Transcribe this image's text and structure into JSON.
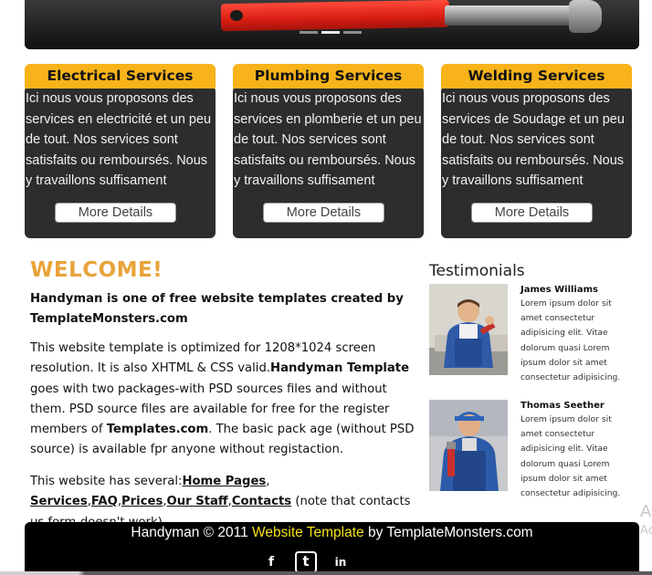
{
  "services": [
    {
      "title": "Electrical Services",
      "text": "Ici nous vous proposons des services en electricité et un peu de tout. Nos services sont satisfaits ou remboursés. Nous y travaillons suffisament",
      "button": "More Details"
    },
    {
      "title": "Plumbing Services",
      "text": "Ici nous vous proposons des services en plomberie et un peu de tout. Nos services sont satisfaits ou remboursés. Nous y travaillons suffisament",
      "button": "More Details"
    },
    {
      "title": "Welding Services",
      "text": "Ici nous vous proposons des services de Soudage et un peu de tout. Nos services sont satisfaits ou remboursés. Nous y travaillons suffisament",
      "button": "More Details"
    }
  ],
  "welcome": {
    "title": "WELCOME!",
    "intro": "Handyman is one of free website templates created by TemplateMonsters.com",
    "p2_a": "This website template is optimized for 1208*1024 screen resolution. It is also XHTML & CSS valid.",
    "p2_b": "Handyman Template",
    "p2_c": " goes with two packages-with PSD sources files and without them. PSD source files are available for free for the register members of ",
    "p2_d": "Templates.com",
    "p2_e": ". The basic pack age (without PSD source) is available fpr anyone without registaction.",
    "p3_a": "This website has several:",
    "links": [
      "Home Pages",
      "Services",
      "FAQ",
      "Prices",
      "Our Staff",
      "Contacts"
    ],
    "p3_b": " (note that contacts us form-doesn't work)."
  },
  "testimonials": {
    "title": "Testimonials",
    "items": [
      {
        "name": "James Williams",
        "text": "Lorem ipsum dolor sit amet consectetur adipisicing elit. Vitae dolorum quasi Lorem ipsum dolor sit amet consectetur adipisicing."
      },
      {
        "name": "Thomas Seether",
        "text": "Lorem ipsum dolor sit amet consectetur adipisicing elit. Vitae dolorum quasi Lorem ipsum dolor sit amet consectetur adipisicing."
      }
    ]
  },
  "footer": {
    "prefix": "Handyman © 2011 ",
    "link": "Website Template",
    "suffix": " by TemplateMonsters.com",
    "social": [
      "f",
      "t",
      "in"
    ]
  },
  "colors": {
    "accent_orange": "#f7b319",
    "welcome_color": "#e8a33a",
    "footer_link": "#f5e11a"
  },
  "slider": {
    "slides": 3,
    "active": 2
  },
  "edge_text": {
    "line1": "A",
    "line2": "Ac"
  }
}
